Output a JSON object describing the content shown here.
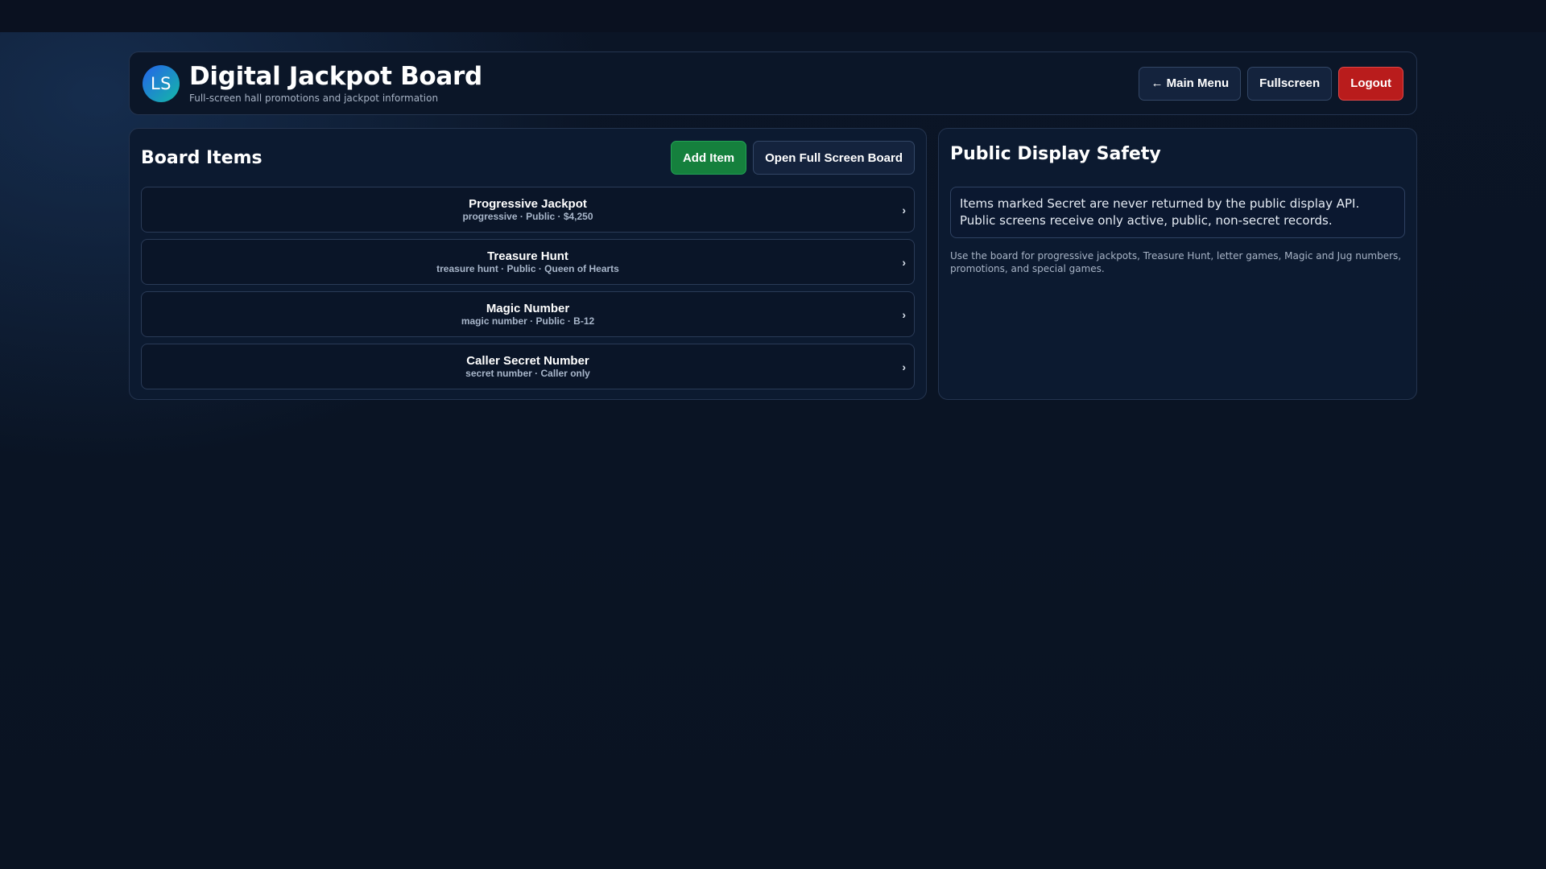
{
  "header": {
    "avatar_initials": "LS",
    "title": "Digital Jackpot Board",
    "subtitle": "Full-screen hall promotions and jackpot information",
    "nav": {
      "main_menu": "← Main Menu",
      "fullscreen": "Fullscreen",
      "logout": "Logout"
    }
  },
  "board": {
    "title": "Board Items",
    "add_item": "Add Item",
    "open_full_screen": "Open Full Screen Board",
    "items": [
      {
        "name": "Progressive Jackpot",
        "meta": "progressive · Public · $4,250"
      },
      {
        "name": "Treasure Hunt",
        "meta": "treasure hunt · Public · Queen of Hearts"
      },
      {
        "name": "Magic Number",
        "meta": "magic number · Public · B-12"
      },
      {
        "name": "Caller Secret Number",
        "meta": "secret number · Caller only"
      }
    ],
    "chevron": "›"
  },
  "safety": {
    "title": "Public Display Safety",
    "notice": "Items marked Secret are never returned by the public display API. Public screens receive only active, public, non-secret records.",
    "note": "Use the board for progressive jackpots, Treasure Hunt, letter games, Magic and Jug numbers, promotions, and special games."
  },
  "colors": {
    "background": "#0a1424",
    "panel": "#0c1a30",
    "accent_green": "#15803d",
    "accent_red": "#b91c1c"
  }
}
